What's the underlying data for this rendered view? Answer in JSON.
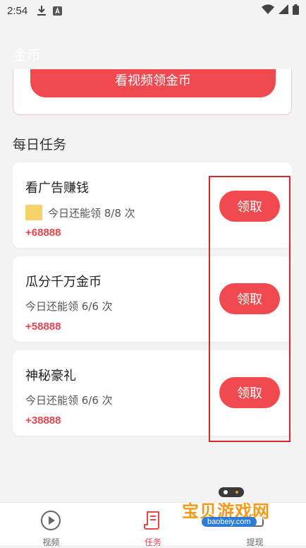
{
  "status_bar": {
    "time": "2:54"
  },
  "header": {
    "title": "金币"
  },
  "top_card": {
    "button_label": "看视频领金币"
  },
  "section": {
    "title": "每日任务"
  },
  "tasks": [
    {
      "name": "看广告赚钱",
      "remaining": "今日还能领 8/8 次",
      "reward": "+68888",
      "button": "领取"
    },
    {
      "name": "瓜分千万金币",
      "remaining": "今日还能领 6/6 次",
      "reward": "+58888",
      "button": "领取"
    },
    {
      "name": "神秘豪礼",
      "remaining": "今日还能领 6/6 次",
      "reward": "+38888",
      "button": "领取"
    }
  ],
  "nav": [
    {
      "label": "视频",
      "icon": "play-circle-icon"
    },
    {
      "label": "任务",
      "icon": "task-list-icon"
    },
    {
      "label": "提现",
      "icon": "withdraw-icon"
    }
  ],
  "watermark": {
    "text": "宝贝游戏网",
    "url": "baobeiy.com"
  },
  "colors": {
    "accent": "#f0494f",
    "reward": "#e8454c",
    "highlight": "#d9252f"
  }
}
